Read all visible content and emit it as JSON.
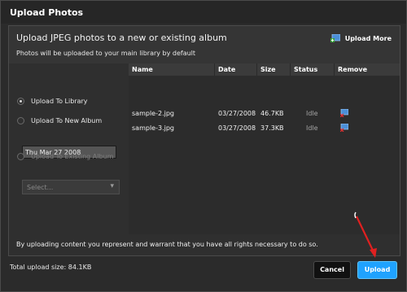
{
  "dialog": {
    "title": "Upload Photos"
  },
  "header": {
    "headline": "Upload JPEG photos to a new or existing album",
    "subline": "Photos will be uploaded to your main library by default",
    "upload_more_label": "Upload More"
  },
  "options": {
    "upload_to_library": "Upload To Library",
    "upload_to_new_album": "Upload To New Album",
    "new_album_date": "Thu Mar 27 2008",
    "upload_to_existing": "Upload To Existing Album",
    "existing_select_placeholder": "Select..."
  },
  "table": {
    "columns": [
      "Name",
      "Date",
      "Size",
      "Status",
      "Remove"
    ],
    "rows": [
      {
        "name": "sample-2.jpg",
        "date": "03/27/2008",
        "size": "46.7KB",
        "status": "Idle"
      },
      {
        "name": "sample-3.jpg",
        "date": "03/27/2008",
        "size": "37.3KB",
        "status": "Idle"
      }
    ]
  },
  "footer": {
    "rights_text": "By uploading content you represent and warrant that you have all rights necessary to do so.",
    "total_size": "Total upload size: 84.1KB",
    "cancel_label": "Cancel",
    "upload_label": "Upload"
  },
  "colors": {
    "accent": "#1fa2ff",
    "annotation_arrow": "#e02020"
  },
  "icons": {
    "upload_more": "image-add-icon",
    "remove": "image-remove-icon"
  }
}
